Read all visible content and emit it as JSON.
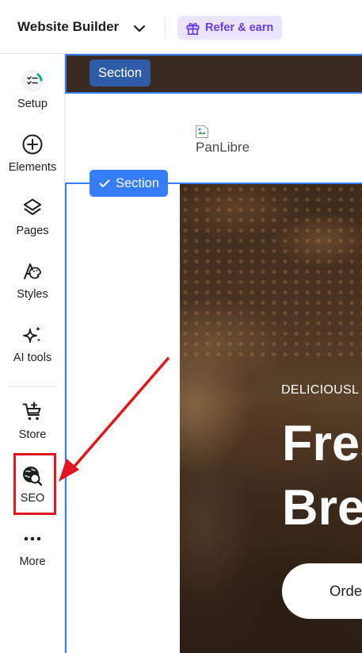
{
  "app": {
    "title": "Website Builder",
    "refer_label": "Refer & earn"
  },
  "sidebar": {
    "items": [
      {
        "label": "Setup",
        "icon": "setup-progress-icon"
      },
      {
        "label": "Elements",
        "icon": "add-circle-icon"
      },
      {
        "label": "Pages",
        "icon": "layers-icon"
      },
      {
        "label": "Styles",
        "icon": "palette-icon"
      },
      {
        "label": "AI tools",
        "icon": "sparkles-icon"
      },
      {
        "label": "Store",
        "icon": "cart-add-icon"
      },
      {
        "label": "SEO",
        "icon": "seo-search-icon"
      },
      {
        "label": "More",
        "icon": "more-dots-icon"
      }
    ]
  },
  "canvas": {
    "header_section_tag": "Section",
    "hero_section_tag": "Section",
    "logo_alt": "PanLibre",
    "hero_eyebrow": "DELICIOUSL",
    "hero_title_line1": "Fres",
    "hero_title_line2": "Bre",
    "order_button": "Orde"
  },
  "colors": {
    "brand_purple": "#673de6",
    "refer_bg": "#ebe4ff",
    "selection_blue": "#357df9",
    "highlight_red": "#e1161f",
    "header_brown": "#3a2a1f"
  }
}
